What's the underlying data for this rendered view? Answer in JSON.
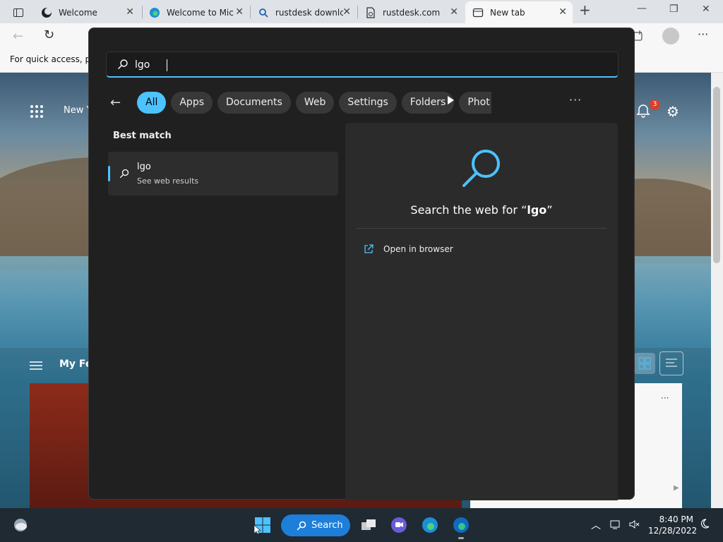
{
  "browser": {
    "tabs": [
      {
        "label": "Welcome",
        "icon": "theme-moon-icon"
      },
      {
        "label": "Welcome to Mic",
        "icon": "edge-icon"
      },
      {
        "label": "rustdesk downlc",
        "icon": "search-icon"
      },
      {
        "label": "rustdesk.com",
        "icon": "page-icon"
      },
      {
        "label": "New tab",
        "icon": "newtab-icon"
      }
    ],
    "close_glyph": "✕",
    "new_tab_glyph": "+",
    "favorites_text": "For quick access, plac"
  },
  "ntp": {
    "menu_label": "New Y",
    "feed_label": "My Fe",
    "notification_count": "3",
    "card_more": "···"
  },
  "search": {
    "query": "lgo",
    "filters": [
      "All",
      "Apps",
      "Documents",
      "Web",
      "Settings",
      "Folders",
      "Phot"
    ],
    "active_filter": "All",
    "more_glyph": "···",
    "best_match_heading": "Best match",
    "result": {
      "title": "lgo",
      "subtitle": "See web results"
    },
    "preview": {
      "title_prefix": "Search the web for “",
      "title_query": "lgo",
      "title_suffix": "”",
      "action_label": "Open in browser"
    }
  },
  "taskbar": {
    "search_label": "Search",
    "time": "8:40 PM",
    "date": "12/28/2022"
  },
  "colors": {
    "accent": "#4cc2ff",
    "flyout_bg": "#202020",
    "taskbar_search": "#1d7fd9"
  }
}
